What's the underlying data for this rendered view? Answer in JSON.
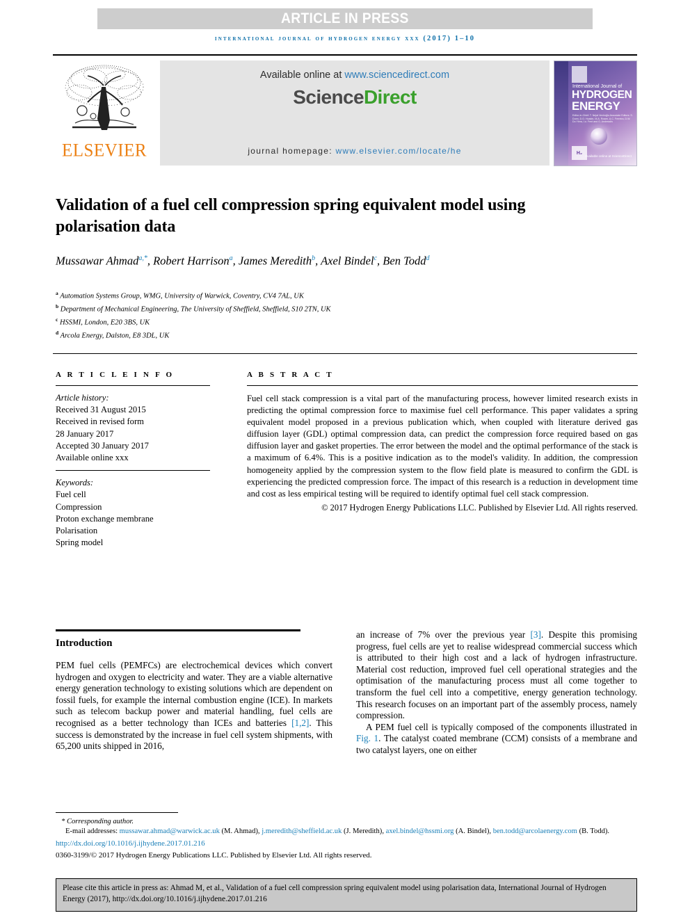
{
  "banner": {
    "article_in_press": "ARTICLE IN PRESS"
  },
  "running_head": "INTERNATIONAL JOURNAL OF HYDROGEN ENERGY XXX (2017) 1–10",
  "masthead": {
    "publisher": "ELSEVIER",
    "available_prefix": "Available online at ",
    "available_url": "www.sciencedirect.com",
    "sciencedirect_part1": "Science",
    "sciencedirect_part2": "Direct",
    "homepage_label": "journal homepage: ",
    "homepage_url": "www.elsevier.com/locate/he",
    "cover": {
      "line_small": "International Journal of",
      "line_big1": "HYDROGEN",
      "line_big2": "ENERGY",
      "editors": "Editor-in-Chief: T. Nejat Veziroğlu\nAssociate Editors: S. Dunn, D.O. Hoaldn, M.A. Rosen, A.C. Ferreira, D.W. Do Ylera, I.o. Fent and G. Andreadis",
      "he_mark": "H₂",
      "sd_footer": "Available online at\nScienceDirect"
    }
  },
  "article": {
    "title": "Validation of a fuel cell compression spring equivalent model using polarisation data",
    "authors": [
      {
        "name": "Mussawar Ahmad",
        "marks": "a,*"
      },
      {
        "name": "Robert Harrison",
        "marks": "a"
      },
      {
        "name": "James Meredith",
        "marks": "b"
      },
      {
        "name": "Axel Bindel",
        "marks": "c"
      },
      {
        "name": "Ben Todd",
        "marks": "d"
      }
    ],
    "affiliations": [
      {
        "mark": "a",
        "text": "Automation Systems Group, WMG, University of Warwick, Coventry, CV4 7AL, UK"
      },
      {
        "mark": "b",
        "text": "Department of Mechanical Engineering, The University of Sheffield, Sheffield, S10 2TN, UK"
      },
      {
        "mark": "c",
        "text": "HSSMI, London, E20 3BS, UK"
      },
      {
        "mark": "d",
        "text": "Arcola Energy, Dalston, E8 3DL, UK"
      }
    ]
  },
  "article_info": {
    "heading": "A R T I C L E   I N F O",
    "history_label": "Article history:",
    "history": [
      "Received 31 August 2015",
      "Received in revised form",
      "28 January 2017",
      "Accepted 30 January 2017",
      "Available online xxx"
    ],
    "keywords_label": "Keywords:",
    "keywords": [
      "Fuel cell",
      "Compression",
      "Proton exchange membrane",
      "Polarisation",
      "Spring model"
    ]
  },
  "abstract": {
    "heading": "A B S T R A C T",
    "text": "Fuel cell stack compression is a vital part of the manufacturing process, however limited research exists in predicting the optimal compression force to maximise fuel cell performance. This paper validates a spring equivalent model proposed in a previous publication which, when coupled with literature derived gas diffusion layer (GDL) optimal compression data, can predict the compression force required based on gas diffusion layer and gasket properties. The error between the model and the optimal performance of the stack is a maximum of 6.4%. This is a positive indication as to the model's validity. In addition, the compression homogeneity applied by the compression system to the flow field plate is measured to confirm the GDL is experiencing the predicted compression force. The impact of this research is a reduction in development time and cost as less empirical testing will be required to identify optimal fuel cell stack compression.",
    "copyright": "© 2017 Hydrogen Energy Publications LLC. Published by Elsevier Ltd. All rights reserved."
  },
  "body": {
    "intro_heading": "Introduction",
    "left_paragraph_1a": "PEM fuel cells (PEMFCs) are electrochemical devices which convert hydrogen and oxygen to electricity and water. They are a viable alternative energy generation technology to existing solutions which are dependent on fossil fuels, for example the internal combustion engine (ICE). In markets such as telecom backup power and material handling, fuel cells are recognised as a better technology than ICEs and batteries ",
    "left_cite_1": "[1,2]",
    "left_paragraph_1b": ". This success is demonstrated by the increase in fuel cell system shipments, with 65,200 units shipped in 2016,",
    "right_paragraph_1a": "an increase of 7% over the previous year ",
    "right_cite_3": "[3]",
    "right_paragraph_1b": ". Despite this promising progress, fuel cells are yet to realise widespread commercial success which is attributed to their high cost and a lack of hydrogen infrastructure. Material cost reduction, improved fuel cell operational strategies and the optimisation of the manufacturing process must all come together to transform the fuel cell into a competitive, energy generation technology. This research focuses on an important part of the assembly process, namely compression.",
    "right_paragraph_2a": "A PEM fuel cell is typically composed of the components illustrated in ",
    "right_fig_link": "Fig. 1",
    "right_paragraph_2b": ". The catalyst coated membrane (CCM) consists of a membrane and two catalyst layers, one on either"
  },
  "footer": {
    "corresponding": "* Corresponding author.",
    "email_label": "E-mail addresses: ",
    "emails": [
      {
        "address": "mussawar.ahmad@warwick.ac.uk",
        "who": " (M. Ahmad), "
      },
      {
        "address": "j.meredith@sheffield.ac.uk",
        "who": " (J. Meredith), "
      },
      {
        "address": "axel.bindel@hssmi.org",
        "who": " (A. Bindel), "
      },
      {
        "address": "ben.todd@arcolaenergy.com",
        "who": " (B. Todd)."
      }
    ],
    "doi": "http://dx.doi.org/10.1016/j.ijhydene.2017.01.216",
    "issn_line": "0360-3199/© 2017 Hydrogen Energy Publications LLC. Published by Elsevier Ltd. All rights reserved."
  },
  "cite_box": {
    "text": "Please cite this article in press as: Ahmad M, et al., Validation of a fuel cell compression spring equivalent model using polarisation data, International Journal of Hydrogen Energy (2017), http://dx.doi.org/10.1016/j.ijhydene.2017.01.216"
  },
  "colors": {
    "link_blue": "#1a7fb8",
    "elsevier_orange": "#ec8013",
    "sciencedirect_green": "#3aa02c",
    "banner_gray": "#cdcdcd",
    "cite_box_gray": "#c8c8c8"
  }
}
